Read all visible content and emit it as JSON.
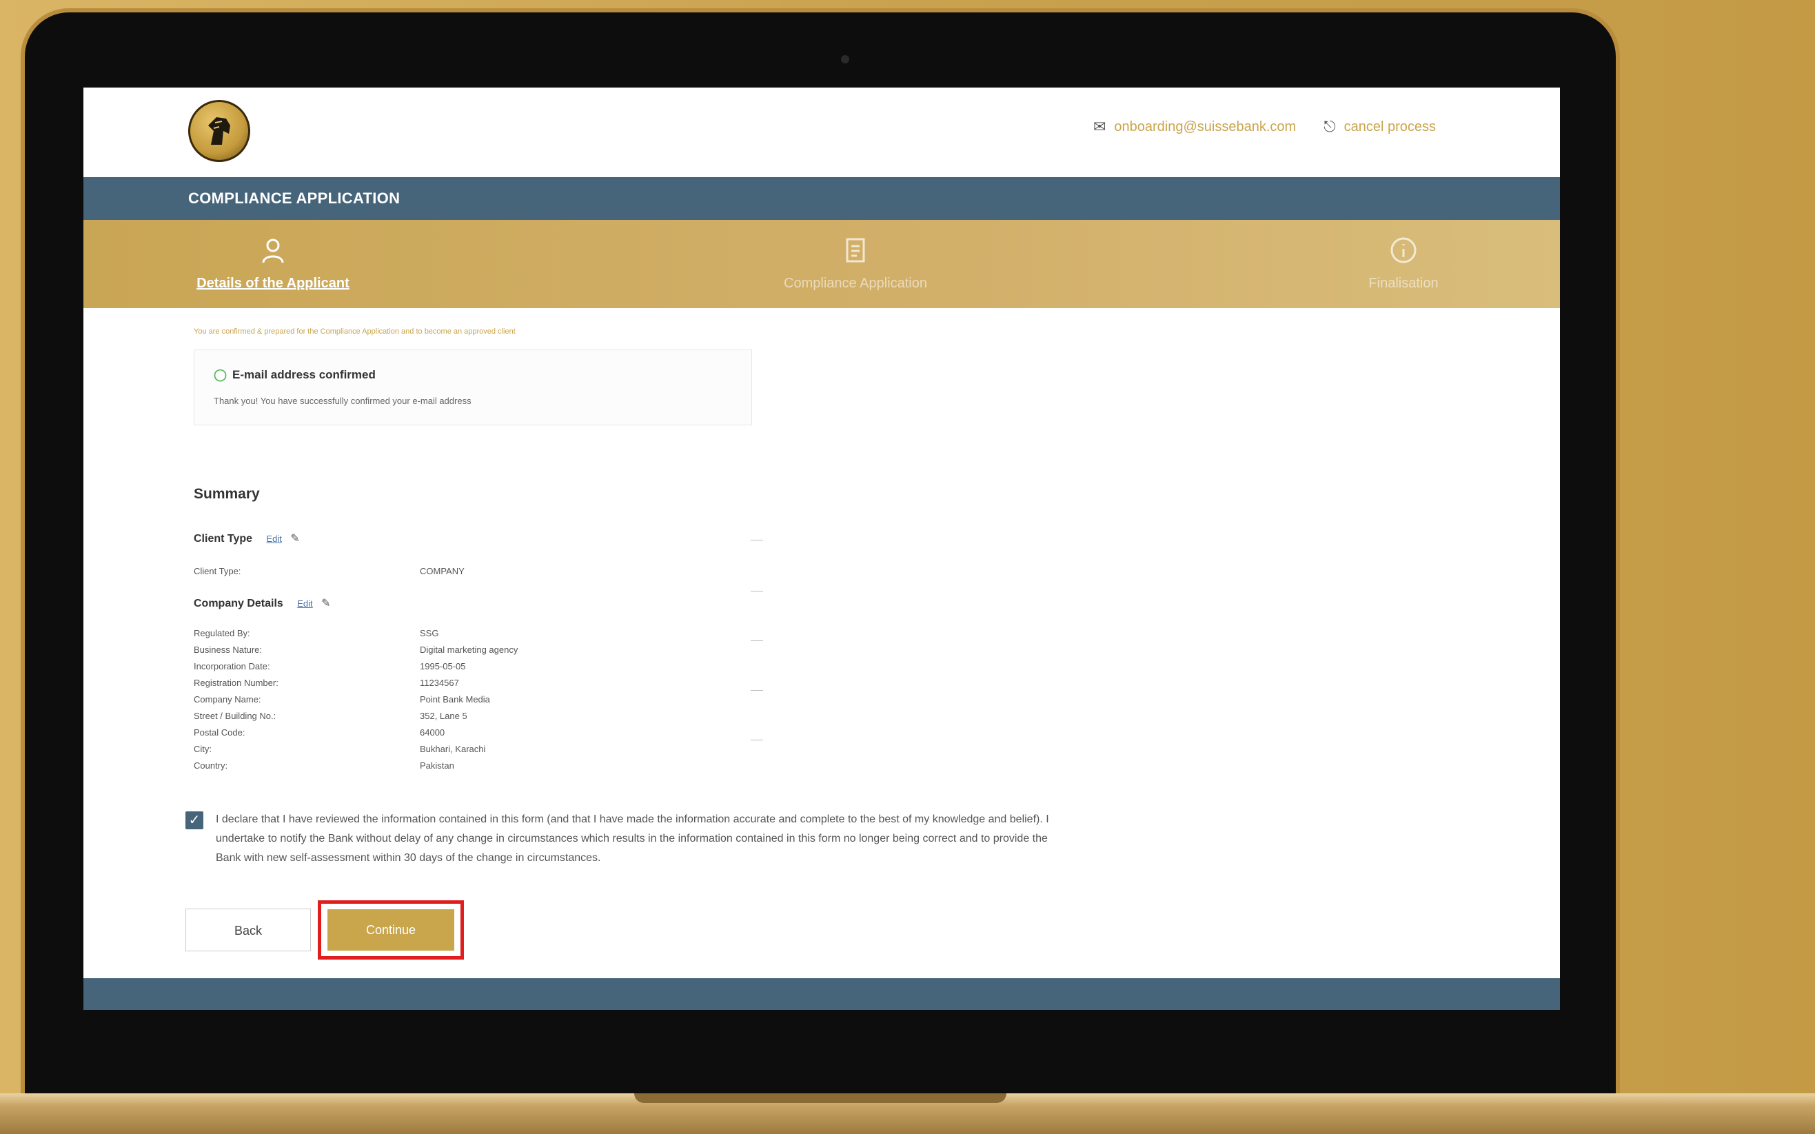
{
  "header": {
    "email": "onboarding@suissebank.com",
    "cancel": "cancel process"
  },
  "title": "COMPLIANCE APPLICATION",
  "steps": [
    {
      "label": "Details of the Applicant"
    },
    {
      "label": "Compliance Application"
    },
    {
      "label": "Finalisation"
    }
  ],
  "notice": {
    "hint": "You are confirmed & prepared for the Compliance Application and to become an approved client",
    "title": "E-mail address confirmed",
    "text": "Thank you! You have successfully confirmed your e-mail address"
  },
  "summary": {
    "title": "Summary",
    "edit_label": "Edit",
    "client_type_section": "Client Type",
    "client_type_rows": [
      {
        "k": "Client Type:",
        "v": "COMPANY"
      }
    ],
    "company_section": "Company Details",
    "company_rows": [
      {
        "k": "Regulated By:",
        "v": "SSG"
      },
      {
        "k": "Business Nature:",
        "v": "Digital marketing agency"
      },
      {
        "k": "Incorporation Date:",
        "v": "1995-05-05"
      },
      {
        "k": "Registration Number:",
        "v": "11234567"
      },
      {
        "k": "Company Name:",
        "v": "Point Bank Media"
      },
      {
        "k": "Street / Building No.:",
        "v": "352, Lane 5"
      },
      {
        "k": "Postal Code:",
        "v": "64000"
      },
      {
        "k": "City:",
        "v": "Bukhari, Karachi"
      },
      {
        "k": "Country:",
        "v": "Pakistan"
      }
    ]
  },
  "declaration": {
    "checked": true,
    "text": "I declare that I have reviewed the information contained in this form (and that I have made the information accurate and complete to the best of my knowledge and belief). I undertake to notify the Bank without delay of any change in circumstances which results in the information contained in this form no longer being correct and to provide the Bank with new self-assessment within 30 days of the change in circumstances."
  },
  "buttons": {
    "back": "Back",
    "continue": "Continue"
  },
  "colors": {
    "gold": "#c9a54c",
    "slate": "#46647a",
    "highlight": "#e01e1e"
  }
}
